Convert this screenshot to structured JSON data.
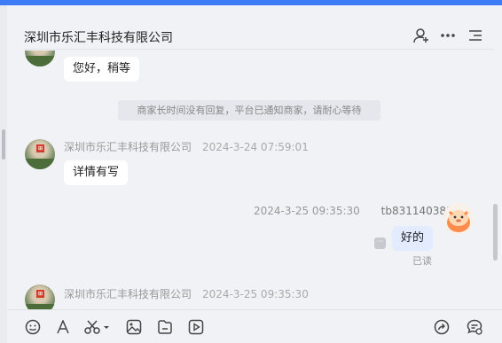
{
  "header": {
    "title": "深圳市乐汇丰科技有限公司",
    "icons": [
      "add-person-icon",
      "more-icon",
      "list-icon"
    ]
  },
  "messages": {
    "m1": {
      "text": "您好，稍等"
    },
    "system_notice": "商家长时间没有回复，平台已通知商家，请耐心等待",
    "m2": {
      "sender": "深圳市乐汇丰科技有限公司",
      "time": "2024-3-24 07:59:01",
      "text": "详情有写"
    },
    "m3": {
      "sender": "tb831140381",
      "time": "2024-3-25 09:35:30",
      "text": "好的",
      "status": "已读"
    },
    "m4": {
      "sender": "深圳市乐汇丰科技有限公司",
      "time": "2024-3-25 09:35:30"
    }
  },
  "toolbar": {
    "icons": [
      "emoji-icon",
      "font-icon",
      "scissors-icon",
      "image-icon",
      "file-icon",
      "video-icon",
      "share-icon",
      "chat-settings-icon"
    ]
  },
  "colors": {
    "accent": "#3e7cf5",
    "bubble_mine": "#e3ecff",
    "background": "#f1f2f6"
  }
}
